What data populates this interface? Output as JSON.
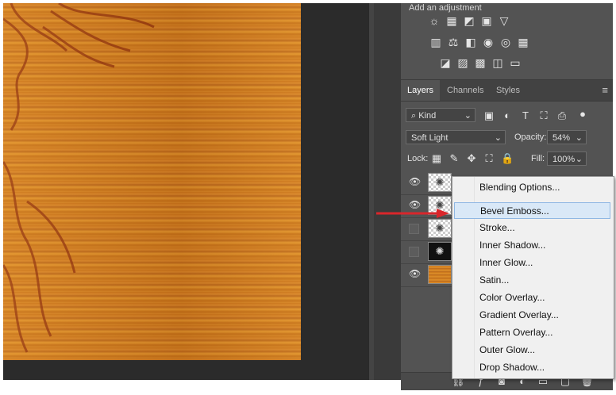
{
  "adjustments": {
    "title": "Add an adjustment",
    "rows": [
      [
        "brightness-contrast-icon",
        "levels-icon",
        "curves-icon",
        "exposure-icon",
        "vibrance-icon"
      ],
      [
        "hue-saturation-icon",
        "color-balance-icon",
        "black-white-icon",
        "photo-filter-icon",
        "channel-mixer-icon",
        "color-lookup-icon"
      ],
      [
        "invert-icon",
        "posterize-icon",
        "threshold-icon",
        "selective-color-icon",
        "gradient-map-icon"
      ]
    ],
    "glyphs": [
      [
        "☼",
        "▦",
        "◩",
        "▣",
        "▽"
      ],
      [
        "▥",
        "⚖",
        "◧",
        "◉",
        "◎",
        "▦"
      ],
      [
        "◪",
        "▨",
        "▩",
        "◫",
        "▭"
      ]
    ]
  },
  "tabs": [
    {
      "label": "Layers",
      "active": true
    },
    {
      "label": "Channels",
      "active": false
    },
    {
      "label": "Styles",
      "active": false
    }
  ],
  "filter": {
    "kind_label": "Kind",
    "icons": [
      "image-filter-icon",
      "adjustment-filter-icon",
      "type-filter-icon",
      "shape-filter-icon",
      "smart-object-filter-icon"
    ]
  },
  "blend": {
    "mode": "Soft Light",
    "opacity_label": "Opacity:",
    "opacity_value": "54%"
  },
  "lock": {
    "label": "Lock:",
    "fill_label": "Fill:",
    "fill_value": "100%"
  },
  "layers": [
    {
      "visible": true,
      "thumb": "checker"
    },
    {
      "visible": true,
      "thumb": "checker"
    },
    {
      "visible": false,
      "thumb": "checker"
    },
    {
      "visible": false,
      "thumb": "dark"
    },
    {
      "visible": true,
      "thumb": "wood"
    }
  ],
  "context_menu": {
    "items": [
      "Blending Options...",
      "Bevel  Emboss...",
      "Stroke...",
      "Inner Shadow...",
      "Inner Glow...",
      "Satin...",
      "Color Overlay...",
      "Gradient Overlay...",
      "Pattern Overlay...",
      "Outer Glow...",
      "Drop Shadow..."
    ],
    "highlighted_index": 1
  },
  "colors": {
    "panel": "#535353",
    "highlight": "#d9e8f7",
    "arrow": "#d9262b",
    "wood": "#c9741a"
  }
}
